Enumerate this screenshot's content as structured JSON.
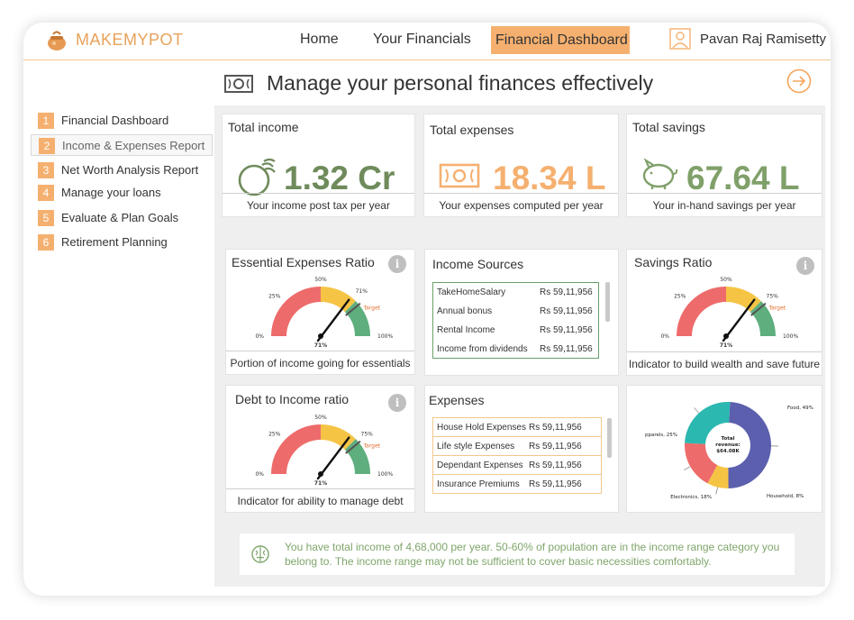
{
  "brand": {
    "name": "MAKEMYPOT"
  },
  "nav": {
    "home": "Home",
    "financials": "Your Financials",
    "dashboard": "Financial Dashboard"
  },
  "user": {
    "name": "Pavan Raj Ramisetty"
  },
  "page": {
    "title": "Manage your personal finances effectively"
  },
  "sidebar": {
    "items": [
      {
        "num": "1",
        "label": "Financial Dashboard"
      },
      {
        "num": "2",
        "label": "Income & Expenses Report"
      },
      {
        "num": "3",
        "label": "Net Worth Analysis Report"
      },
      {
        "num": "4",
        "label": "Manage your loans"
      },
      {
        "num": "5",
        "label": "Evaluate & Plan Goals"
      },
      {
        "num": "6",
        "label": "Retirement Planning"
      }
    ],
    "active_index": 1
  },
  "cards": {
    "income": {
      "title": "Total income",
      "value": "1.32 Cr",
      "foot": "Your income post tax per year",
      "color": "#6f8b5b"
    },
    "expenses": {
      "title": "Total expenses",
      "value": "18.34 L",
      "foot": "Your expenses computed per year",
      "color": "#f5b070"
    },
    "savings": {
      "title": "Total savings",
      "value": "67.64 L",
      "foot": "Your in-hand savings per year",
      "color": "#80a06a"
    }
  },
  "gauges": {
    "essential": {
      "title": "Essential Expenses Ratio",
      "foot": "Portion of income going for essentials",
      "value": "71%",
      "value_num": 71,
      "target_label": "Target",
      "ticks": [
        "0%",
        "25%",
        "50%",
        "71%",
        "100%"
      ]
    },
    "savings": {
      "title": "Savings Ratio",
      "foot": "Indicator to build wealth and save future",
      "value": "71%",
      "value_num": 71,
      "target_label": "Target",
      "ticks": [
        "0%",
        "25%",
        "50%",
        "75%",
        "100%"
      ]
    },
    "debt": {
      "title": "Debt to Income ratio",
      "foot": "Indicator for ability to manage debt",
      "value": "71%",
      "value_num": 71,
      "target_label": "Target",
      "ticks": [
        "0%",
        "25%",
        "50%",
        "75%",
        "100%"
      ]
    }
  },
  "income_sources": {
    "title": "Income Sources",
    "rows": [
      {
        "name": "TakeHomeSalary",
        "amount": "Rs 59,11,956"
      },
      {
        "name": "Annual bonus",
        "amount": "Rs 59,11,956"
      },
      {
        "name": "Rental Income",
        "amount": "Rs 59,11,956"
      },
      {
        "name": "Income from dividends",
        "amount": "Rs 59,11,956"
      }
    ]
  },
  "expenses_list": {
    "title": "Expenses",
    "rows": [
      {
        "name": "House Hold Expenses",
        "amount": "Rs 59,11,956"
      },
      {
        "name": "Life style Expenses",
        "amount": "Rs 59,11,956"
      },
      {
        "name": "Dependant Expenses",
        "amount": "Rs 59,11,956"
      },
      {
        "name": "Insurance Premiums",
        "amount": "Rs 59,11,956"
      }
    ]
  },
  "chart_data": {
    "type": "pie",
    "center_label": [
      "Total",
      "revenue:",
      "$64.08K"
    ],
    "slices": [
      {
        "label": "Food, 49%",
        "value": 49,
        "color": "#5b5fad"
      },
      {
        "label": "Household, 8%",
        "value": 8,
        "color": "#f6c445"
      },
      {
        "label": "Electronics, 18%",
        "value": 18,
        "color": "#ee6b6b"
      },
      {
        "label": "pparels, 25%",
        "value": 25,
        "color": "#2bb8b0"
      }
    ]
  },
  "insight": {
    "text": "You have total income of 4,68,000 per year. 50-60% of population are in the income range category you belong to.  The income range may not be sufficient to cover basic necessities comfortably."
  },
  "colors": {
    "accent": "#f5b070",
    "green": "#6f8b5b",
    "gauge_red": "#ee6b6b",
    "gauge_yellow": "#f6c445",
    "gauge_green": "#5fae7e"
  }
}
